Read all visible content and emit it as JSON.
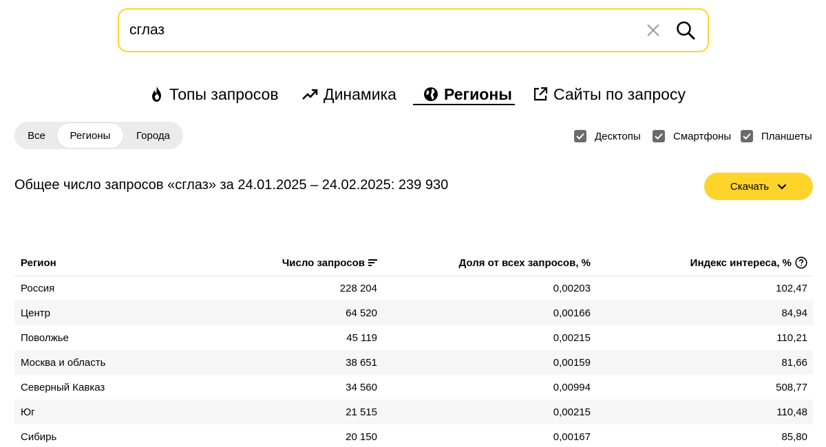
{
  "search": {
    "value": "сглаз"
  },
  "tabs": [
    {
      "label": "Топы запросов",
      "icon": "fire-icon"
    },
    {
      "label": "Динамика",
      "icon": "trend-up-icon"
    },
    {
      "label": "Регионы",
      "icon": "globe-icon",
      "active": true
    },
    {
      "label": "Сайты по запросу",
      "icon": "external-link-icon"
    }
  ],
  "segment": {
    "items": [
      "Все",
      "Регионы",
      "Города"
    ],
    "active": "Регионы"
  },
  "devices": [
    {
      "label": "Десктопы",
      "checked": true
    },
    {
      "label": "Смартфоны",
      "checked": true
    },
    {
      "label": "Планшеты",
      "checked": true
    }
  ],
  "summary": "Общее число запросов «сглаз» за 24.01.2025 – 24.02.2025: 239 930",
  "download": {
    "label": "Скачать"
  },
  "table": {
    "headers": [
      "Регион",
      "Число запросов",
      "Доля от всех запросов, %",
      "Индекс интереса, %"
    ],
    "rows": [
      [
        "Россия",
        "228 204",
        "0,00203",
        "102,47"
      ],
      [
        "Центр",
        "64 520",
        "0,00166",
        "84,94"
      ],
      [
        "Поволжье",
        "45 119",
        "0,00215",
        "110,21"
      ],
      [
        "Москва и область",
        "38 651",
        "0,00159",
        "81,66"
      ],
      [
        "Северный Кавказ",
        "34 560",
        "0,00994",
        "508,77"
      ],
      [
        "Юг",
        "21 515",
        "0,00215",
        "110,48"
      ],
      [
        "Сибирь",
        "20 150",
        "0,00167",
        "85,80"
      ]
    ]
  },
  "colors": {
    "accent": "#fed42b",
    "checkbox": "#6b6b6b",
    "row_stripe": "#f6f6f6"
  }
}
